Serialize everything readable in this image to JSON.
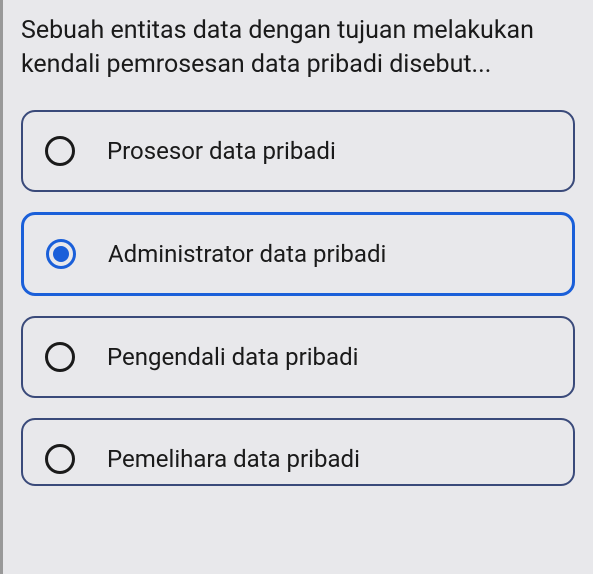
{
  "question": "Sebuah entitas data dengan tujuan melakukan kendali pemrosesan data pribadi disebut...",
  "options": [
    {
      "label": "Prosesor data pribadi",
      "selected": false
    },
    {
      "label": "Administrator data pribadi",
      "selected": true
    },
    {
      "label": "Pengendali data pribadi",
      "selected": false
    },
    {
      "label": "Pemelihara data pribadi",
      "selected": false
    }
  ]
}
